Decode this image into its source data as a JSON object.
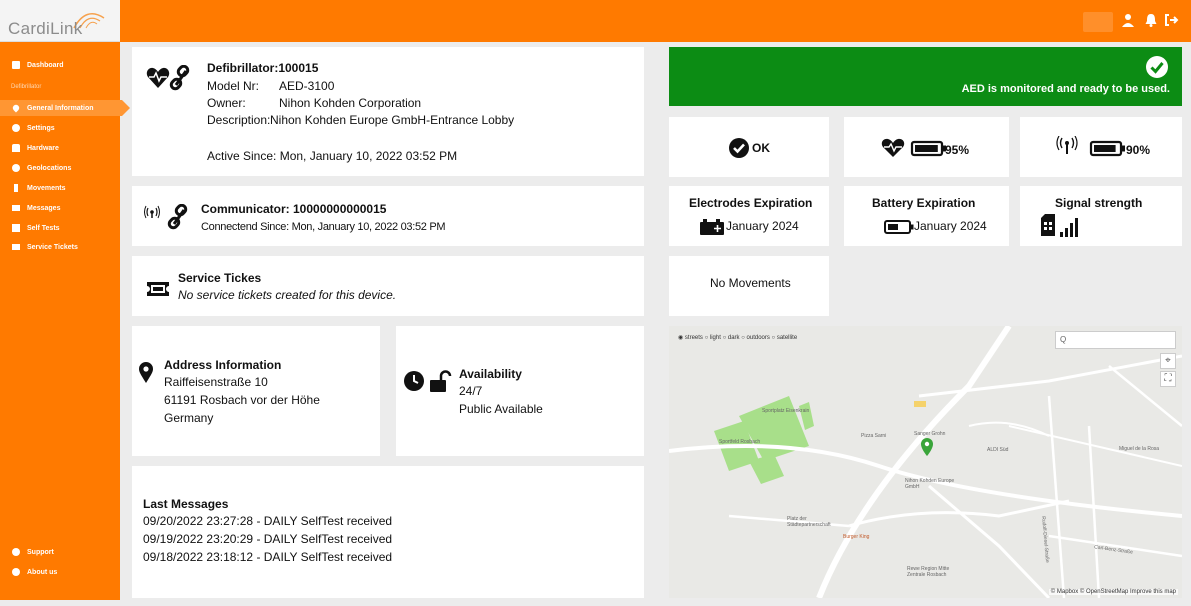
{
  "app": {
    "logo_text": "CardiLink"
  },
  "colors": {
    "brand_orange": "#ff7a00",
    "status_green": "#0c8c14",
    "map_pin": "#3aa53a"
  },
  "topbar": {
    "icons": [
      "user-icon",
      "bell-icon",
      "logout-icon"
    ]
  },
  "sidebar": {
    "items": [
      {
        "label": "Dashboard",
        "icon": "dashboard-icon"
      },
      {
        "label": "General Information",
        "icon": "heart-icon"
      },
      {
        "label": "Settings",
        "icon": "gear-icon"
      },
      {
        "label": "Hardware",
        "icon": "car-icon"
      },
      {
        "label": "Geolocations",
        "icon": "globe-icon"
      },
      {
        "label": "Movements",
        "icon": "walking-icon"
      },
      {
        "label": "Messages",
        "icon": "envelope-icon"
      },
      {
        "label": "Self Tests",
        "icon": "calendar-icon"
      },
      {
        "label": "Service Tickets",
        "icon": "ticket-icon"
      }
    ],
    "section_label": "Defibrillator",
    "bottom_items": [
      {
        "label": "Support",
        "icon": "support-icon"
      },
      {
        "label": "About us",
        "icon": "info-icon"
      }
    ]
  },
  "defibrillator": {
    "title": "Defibrillator:100015",
    "model_label": "Model Nr:",
    "model_value": "AED-3100",
    "owner_label": "Owner:",
    "owner_value": "Nihon Kohden Corporation",
    "description_label": "Description:",
    "description_value": "Nihon Kohden Europe GmbH-Entrance Lobby",
    "active_since": "Active Since: Mon, January 10, 2022 03:52 PM"
  },
  "communicator": {
    "title": "Communicator: 10000000000015",
    "connected_since": "Connectend Since: Mon, January 10, 2022 03:52 PM"
  },
  "service": {
    "title": "Service Tickes",
    "text": "No service tickets created for this device."
  },
  "address": {
    "title": "Address Information",
    "street": "Raiffeisenstraße 10",
    "city": "61191 Rosbach vor der Höhe",
    "country": "Germany"
  },
  "availability": {
    "title": "Availability",
    "hours": "24/7",
    "access": "Public Available"
  },
  "messages": {
    "title": "Last Messages",
    "items": [
      "09/20/2022 23:27:28 - DAILY SelfTest received",
      "09/19/2022 23:20:29 - DAILY SelfTest received",
      "09/18/2022 23:18:12 - DAILY SelfTest received"
    ]
  },
  "status": {
    "message": "AED is monitored and ready to be used.",
    "ok_label": "OK",
    "battery_label": "95%",
    "battery_level": 0.95,
    "signal_label": "90%",
    "signal_level": 0.9
  },
  "expirations": {
    "electrodes_title": "Electrodes Expiration",
    "electrodes_value": "January 2024",
    "battery_title": "Battery Expiration",
    "battery_value": "January 2024",
    "signal_title": "Signal strength"
  },
  "movements": {
    "text": "No Movements"
  },
  "map": {
    "styles": [
      "streets",
      "light",
      "dark",
      "outdoors",
      "satellite"
    ],
    "search_placeholder": "Q",
    "attribution": "© Mapbox © OpenStreetMap Improve this map",
    "labels": [
      "Sportplatz Eisenkrain",
      "Sportfeld Rosbach",
      "Pizza Sarni",
      "Sanger Grohn",
      "ALDI Süd",
      "Nihon Kohden Europe GmbH",
      "Platz der Städtepartnerschaft",
      "Burger King",
      "Rewe Region Mitte Zentrale Rosbach",
      "Rudolf-Diesel-Straße",
      "Carl-Benz-Straße",
      "Miguel de la Rosa"
    ]
  }
}
